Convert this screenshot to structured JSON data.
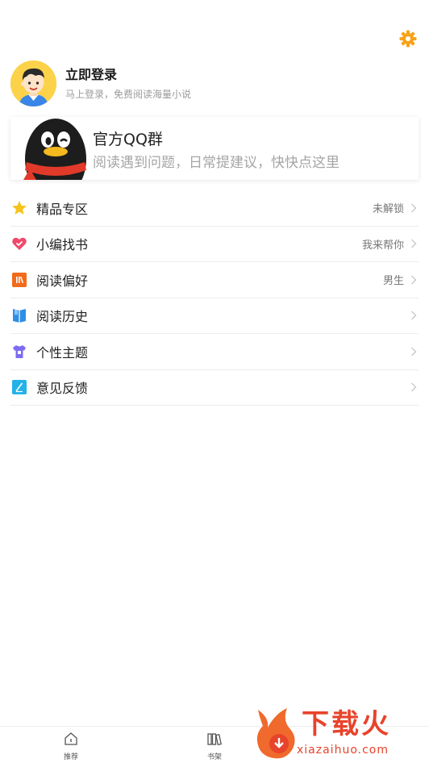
{
  "profile": {
    "title": "立即登录",
    "subtitle": "马上登录，免费阅读海量小说"
  },
  "qq_banner": {
    "title": "官方QQ群",
    "subtitle": "阅读遇到问题，日常提建议，快快点这里"
  },
  "menu": [
    {
      "label": "精品专区",
      "value": "未解锁",
      "icon": "star-icon",
      "color": "#f7c21a"
    },
    {
      "label": "小编找书",
      "value": "我来帮你",
      "icon": "heart-icon",
      "color": "#f0496a"
    },
    {
      "label": "阅读偏好",
      "value": "男生",
      "icon": "books-icon",
      "color": "#f26a1b"
    },
    {
      "label": "阅读历史",
      "value": "",
      "icon": "bookmark-icon",
      "color": "#2d8ee6"
    },
    {
      "label": "个性主题",
      "value": "",
      "icon": "shirt-icon",
      "color": "#7b6cf0"
    },
    {
      "label": "意见反馈",
      "value": "",
      "icon": "feedback-icon",
      "color": "#23b2e8"
    }
  ],
  "tabs": [
    {
      "label": "推荐",
      "icon": "home-icon"
    },
    {
      "label": "书架",
      "icon": "bookshelf-icon"
    }
  ],
  "watermark": {
    "text": "下载火",
    "url": "xiazaihuo.com"
  },
  "colors": {
    "accent": "#f7a21a",
    "brand_watermark": "#e8432b"
  }
}
